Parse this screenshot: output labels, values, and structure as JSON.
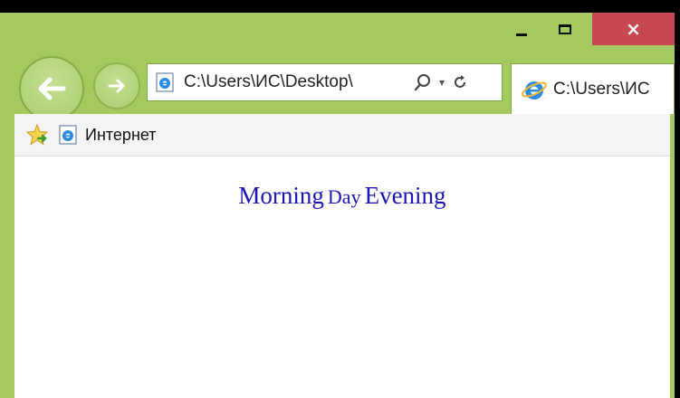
{
  "window_controls": {
    "minimize": "minimize",
    "maximize": "maximize",
    "close": "×"
  },
  "address_bar": {
    "url": "C:\\Users\\ИС\\Desktop\\",
    "tools": [
      "search-icon",
      "dropdown-caret",
      "refresh-icon"
    ]
  },
  "tab": {
    "title": "C:\\Users\\ИС"
  },
  "favorites_bar": {
    "label": "Интернет"
  },
  "page": {
    "words": [
      "Morning",
      "Day",
      "Evening"
    ]
  },
  "colors": {
    "frame": "#a3c95f",
    "close": "#c74752",
    "text_link": "#1b17b5"
  }
}
